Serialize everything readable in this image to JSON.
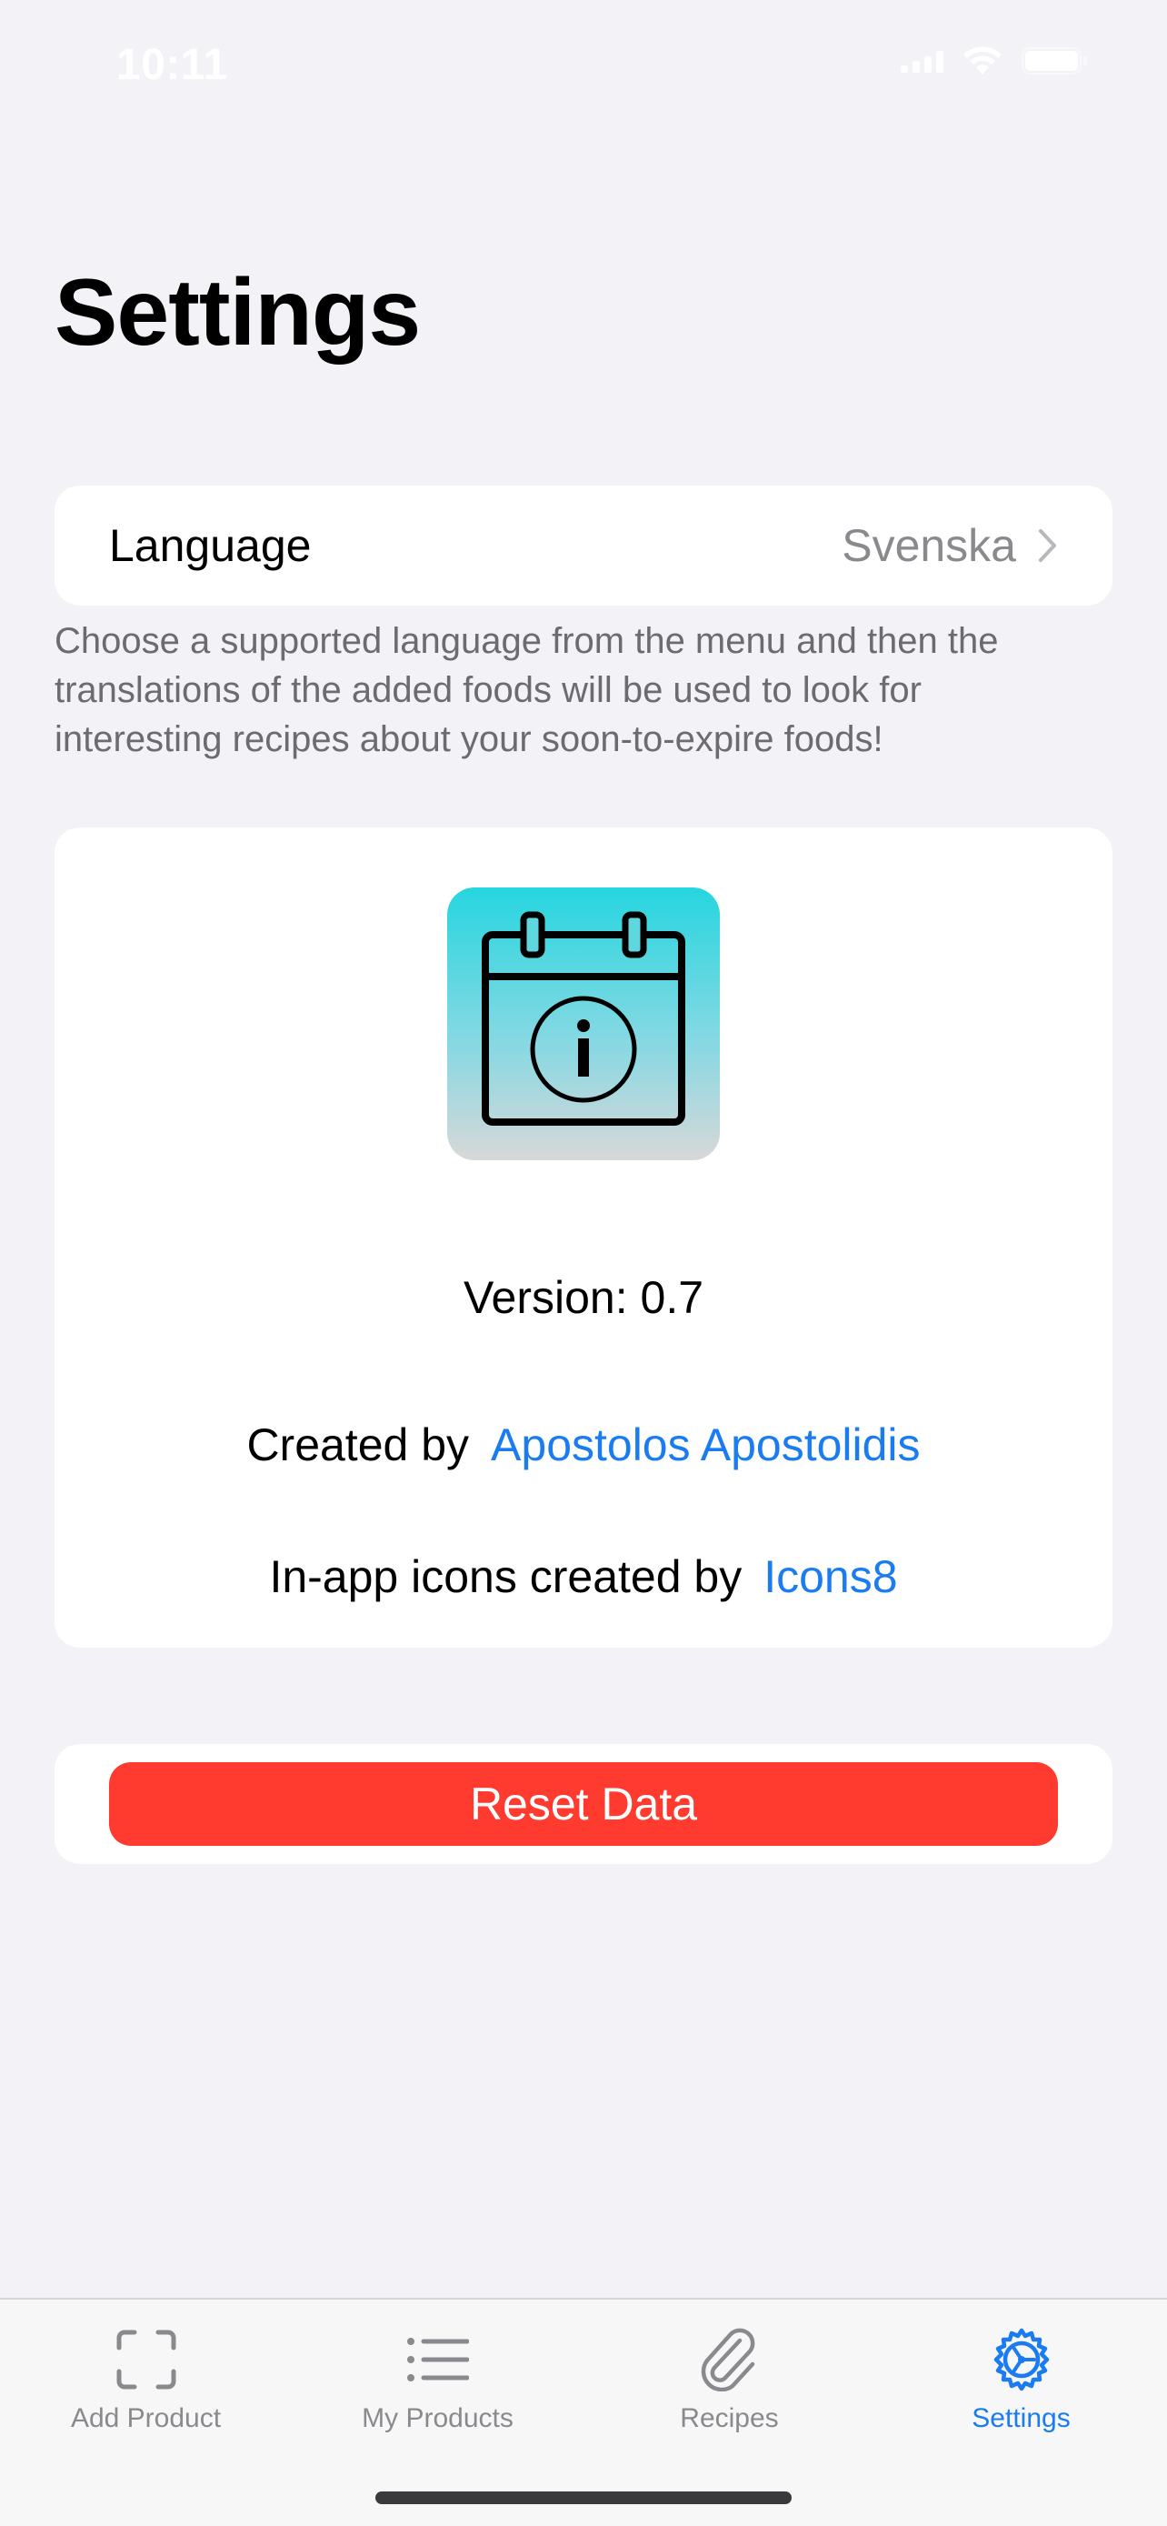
{
  "status_bar": {
    "time": "10:11"
  },
  "header": {
    "title": "Settings"
  },
  "language": {
    "label": "Language",
    "value": "Svenska",
    "footnote": "Choose a supported language from the menu and then the translations of the added foods will be used to look for interesting recipes about your soon-to-expire foods!"
  },
  "about": {
    "version_text": "Version: 0.7",
    "created_by_label": "Created by",
    "author_link": "Apostolos Apostolidis",
    "icons_by_label": "In-app icons created by",
    "icons_link": "Icons8"
  },
  "actions": {
    "reset_label": "Reset Data"
  },
  "tabbar": {
    "tabs": [
      {
        "label": "Add Product",
        "icon": "scan-frame-icon"
      },
      {
        "label": "My Products",
        "icon": "list-icon"
      },
      {
        "label": "Recipes",
        "icon": "paperclip-icon"
      },
      {
        "label": "Settings",
        "icon": "gear-icon"
      }
    ],
    "active_index": 3
  },
  "colors": {
    "background": "#f2f2f7",
    "accent": "#1a7cf0",
    "destructive": "#ff3b30",
    "secondary_text": "#8a8a8e"
  }
}
